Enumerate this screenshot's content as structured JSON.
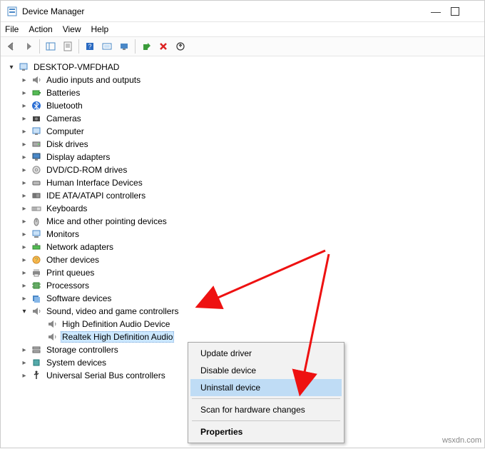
{
  "window": {
    "title": "Device Manager",
    "minimize": "—",
    "close": ""
  },
  "menu": {
    "file": "File",
    "action": "Action",
    "view": "View",
    "help": "Help"
  },
  "tree": {
    "root": "DESKTOP-VMFDHAD",
    "items": [
      {
        "label": "Audio inputs and outputs",
        "icon": "speaker"
      },
      {
        "label": "Batteries",
        "icon": "battery"
      },
      {
        "label": "Bluetooth",
        "icon": "bluetooth"
      },
      {
        "label": "Cameras",
        "icon": "camera"
      },
      {
        "label": "Computer",
        "icon": "computer"
      },
      {
        "label": "Disk drives",
        "icon": "disk"
      },
      {
        "label": "Display adapters",
        "icon": "display"
      },
      {
        "label": "DVD/CD-ROM drives",
        "icon": "dvd"
      },
      {
        "label": "Human Interface Devices",
        "icon": "hid"
      },
      {
        "label": "IDE ATA/ATAPI controllers",
        "icon": "ide"
      },
      {
        "label": "Keyboards",
        "icon": "keyboard"
      },
      {
        "label": "Mice and other pointing devices",
        "icon": "mouse"
      },
      {
        "label": "Monitors",
        "icon": "monitor"
      },
      {
        "label": "Network adapters",
        "icon": "network"
      },
      {
        "label": "Other devices",
        "icon": "other"
      },
      {
        "label": "Print queues",
        "icon": "printer"
      },
      {
        "label": "Processors",
        "icon": "cpu"
      },
      {
        "label": "Software devices",
        "icon": "software"
      },
      {
        "label": "Sound, video and game controllers",
        "icon": "speaker",
        "open": true,
        "children": [
          {
            "label": "High Definition Audio Device",
            "icon": "speaker"
          },
          {
            "label": "Realtek High Definition Audio",
            "icon": "speaker",
            "selected": true
          }
        ]
      },
      {
        "label": "Storage controllers",
        "icon": "storage"
      },
      {
        "label": "System devices",
        "icon": "system"
      },
      {
        "label": "Universal Serial Bus controllers",
        "icon": "usb"
      }
    ]
  },
  "context_menu": {
    "items": [
      {
        "label": "Update driver"
      },
      {
        "label": "Disable device"
      },
      {
        "label": "Uninstall device",
        "highlighted": true
      },
      {
        "sep": true
      },
      {
        "label": "Scan for hardware changes"
      },
      {
        "sep": true
      },
      {
        "label": "Properties",
        "bold": true
      }
    ]
  },
  "watermark": "wsxdn.com"
}
